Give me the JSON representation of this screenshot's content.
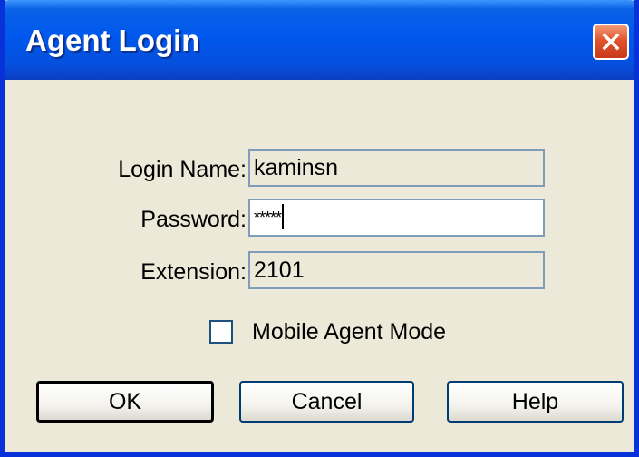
{
  "window": {
    "title": "Agent Login",
    "close_icon": "close-icon"
  },
  "form": {
    "login_name": {
      "label": "Login Name:",
      "value": "kaminsn"
    },
    "password": {
      "label": "Password:",
      "value": "*****"
    },
    "extension": {
      "label": "Extension:",
      "value": "2101"
    },
    "mobile_agent_mode": {
      "label": "Mobile Agent Mode",
      "checked": false
    }
  },
  "buttons": {
    "ok": "OK",
    "cancel": "Cancel",
    "help": "Help"
  },
  "colors": {
    "titlebar": "#0058ee",
    "frame": "#0831d9",
    "dialog_bg": "#ece9d8",
    "close_button": "#e2542c",
    "field_border": "#7f9db9"
  }
}
